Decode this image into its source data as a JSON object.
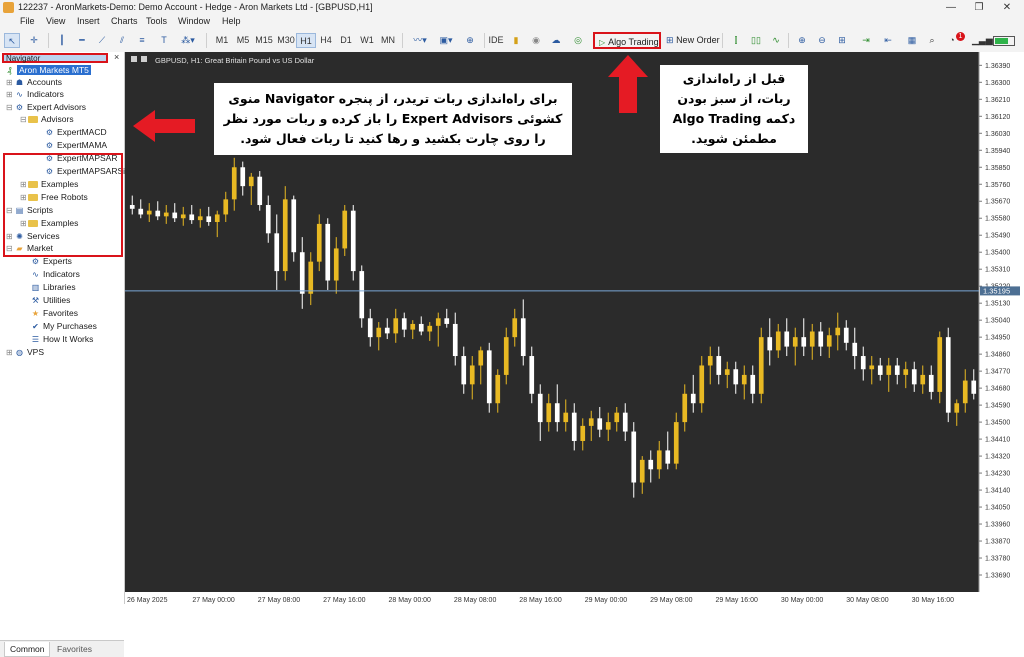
{
  "window": {
    "title": "122237 - AronMarkets-Demo: Demo Account - Hedge - Aron Markets Ltd - [GBPUSD,H1]",
    "controls": [
      "—",
      "❐",
      "✕"
    ]
  },
  "menu": [
    "File",
    "View",
    "Insert",
    "Charts",
    "Tools",
    "Window",
    "Help"
  ],
  "toolbar": {
    "timeframes": [
      "M1",
      "M5",
      "M15",
      "M30",
      "H1",
      "H4",
      "D1",
      "W1",
      "MN"
    ],
    "active_timeframe": "H1",
    "ide_label": "IDE",
    "algo_label": "Algo Trading",
    "new_order_label": "New Order",
    "notification_count": "1"
  },
  "navigator": {
    "title": "Navigator",
    "close": "×",
    "tabs": [
      "Common",
      "Favorites"
    ],
    "items": [
      {
        "label": "Aron Markets MT5"
      },
      {
        "label": "Accounts"
      },
      {
        "label": "Indicators"
      },
      {
        "label": "Expert Advisors"
      },
      {
        "label": "Advisors"
      },
      {
        "label": "ExpertMACD"
      },
      {
        "label": "ExpertMAMA"
      },
      {
        "label": "ExpertMAPSAR"
      },
      {
        "label": "ExpertMAPSARSi"
      },
      {
        "label": "Examples"
      },
      {
        "label": "Free Robots"
      },
      {
        "label": "Scripts"
      },
      {
        "label": "Examples"
      },
      {
        "label": "Services"
      },
      {
        "label": "Market"
      },
      {
        "label": "Experts"
      },
      {
        "label": "Indicators"
      },
      {
        "label": "Libraries"
      },
      {
        "label": "Utilities"
      },
      {
        "label": "Favorites"
      },
      {
        "label": "My Purchases"
      },
      {
        "label": "How It Works"
      },
      {
        "label": "VPS"
      }
    ]
  },
  "chart": {
    "header": "GBPUSD, H1:  Great Britain Pound vs US Dollar",
    "current_price": "1.35195",
    "price_labels": [
      "1.36390",
      "1.36300",
      "1.36210",
      "1.36120",
      "1.36030",
      "1.35940",
      "1.35850",
      "1.35760",
      "1.35670",
      "1.35580",
      "1.35490",
      "1.35400",
      "1.35310",
      "1.35220",
      "1.35130",
      "1.35040",
      "1.34950",
      "1.34860",
      "1.34770",
      "1.34680",
      "1.34590",
      "1.34500",
      "1.34410",
      "1.34320",
      "1.34230",
      "1.34140",
      "1.34050",
      "1.33960",
      "1.33870",
      "1.33780",
      "1.33690"
    ],
    "time_labels": [
      "26 May 2025",
      "27 May 00:00",
      "27 May 08:00",
      "27 May 16:00",
      "28 May 00:00",
      "28 May 08:00",
      "28 May 16:00",
      "29 May 00:00",
      "29 May 08:00",
      "29 May 16:00",
      "30 May 00:00",
      "30 May 08:00",
      "30 May 16:00"
    ]
  },
  "chart_data": {
    "type": "candlestick",
    "symbol": "GBPUSD",
    "timeframe": "H1",
    "ylim": [
      1.336,
      1.3645
    ],
    "bull_color": "#e8b923",
    "bear_color": "#ffffff",
    "bg_color": "#2b2b2b",
    "ohlc": [
      [
        1.3565,
        1.357,
        1.356,
        1.3563
      ],
      [
        1.3563,
        1.3568,
        1.3558,
        1.356
      ],
      [
        1.356,
        1.3566,
        1.3556,
        1.3562
      ],
      [
        1.3562,
        1.3567,
        1.3557,
        1.3559
      ],
      [
        1.3559,
        1.3565,
        1.3555,
        1.3561
      ],
      [
        1.3561,
        1.3566,
        1.3556,
        1.3558
      ],
      [
        1.3558,
        1.3564,
        1.3554,
        1.356
      ],
      [
        1.356,
        1.3565,
        1.3555,
        1.3557
      ],
      [
        1.3557,
        1.3563,
        1.3553,
        1.3559
      ],
      [
        1.3559,
        1.3564,
        1.3554,
        1.3556
      ],
      [
        1.3556,
        1.3562,
        1.3548,
        1.356
      ],
      [
        1.356,
        1.3572,
        1.3556,
        1.3568
      ],
      [
        1.3568,
        1.359,
        1.3562,
        1.3585
      ],
      [
        1.3585,
        1.3588,
        1.357,
        1.3575
      ],
      [
        1.3575,
        1.3582,
        1.3565,
        1.358
      ],
      [
        1.358,
        1.3583,
        1.3562,
        1.3565
      ],
      [
        1.3565,
        1.357,
        1.3545,
        1.355
      ],
      [
        1.355,
        1.356,
        1.352,
        1.353
      ],
      [
        1.353,
        1.3575,
        1.3525,
        1.3568
      ],
      [
        1.3568,
        1.357,
        1.3535,
        1.354
      ],
      [
        1.354,
        1.3548,
        1.351,
        1.3518
      ],
      [
        1.3518,
        1.354,
        1.3512,
        1.3535
      ],
      [
        1.3535,
        1.356,
        1.353,
        1.3555
      ],
      [
        1.3555,
        1.3558,
        1.352,
        1.3525
      ],
      [
        1.3525,
        1.3548,
        1.3518,
        1.3542
      ],
      [
        1.3542,
        1.3565,
        1.3538,
        1.3562
      ],
      [
        1.3562,
        1.3565,
        1.3525,
        1.353
      ],
      [
        1.353,
        1.3533,
        1.35,
        1.3505
      ],
      [
        1.3505,
        1.351,
        1.349,
        1.3495
      ],
      [
        1.3495,
        1.3503,
        1.3488,
        1.35
      ],
      [
        1.35,
        1.3505,
        1.3494,
        1.3497
      ],
      [
        1.3497,
        1.351,
        1.3492,
        1.3505
      ],
      [
        1.3505,
        1.3508,
        1.3495,
        1.3499
      ],
      [
        1.3499,
        1.3504,
        1.3494,
        1.3502
      ],
      [
        1.3502,
        1.3506,
        1.3496,
        1.3498
      ],
      [
        1.3498,
        1.3503,
        1.3493,
        1.3501
      ],
      [
        1.3501,
        1.3508,
        1.349,
        1.3505
      ],
      [
        1.3505,
        1.351,
        1.35,
        1.3502
      ],
      [
        1.3502,
        1.3508,
        1.348,
        1.3485
      ],
      [
        1.3485,
        1.349,
        1.3465,
        1.347
      ],
      [
        1.347,
        1.3485,
        1.3462,
        1.348
      ],
      [
        1.348,
        1.349,
        1.347,
        1.3488
      ],
      [
        1.3488,
        1.3492,
        1.3455,
        1.346
      ],
      [
        1.346,
        1.3478,
        1.3455,
        1.3475
      ],
      [
        1.3475,
        1.35,
        1.347,
        1.3495
      ],
      [
        1.3495,
        1.351,
        1.349,
        1.3505
      ],
      [
        1.3505,
        1.3515,
        1.348,
        1.3485
      ],
      [
        1.3485,
        1.349,
        1.346,
        1.3465
      ],
      [
        1.3465,
        1.347,
        1.344,
        1.345
      ],
      [
        1.345,
        1.3465,
        1.3445,
        1.346
      ],
      [
        1.346,
        1.347,
        1.3445,
        1.345
      ],
      [
        1.345,
        1.3462,
        1.3445,
        1.3455
      ],
      [
        1.3455,
        1.346,
        1.3435,
        1.344
      ],
      [
        1.344,
        1.3452,
        1.3435,
        1.3448
      ],
      [
        1.3448,
        1.3456,
        1.344,
        1.3452
      ],
      [
        1.3452,
        1.3458,
        1.3442,
        1.3446
      ],
      [
        1.3446,
        1.3455,
        1.344,
        1.345
      ],
      [
        1.345,
        1.3458,
        1.3445,
        1.3455
      ],
      [
        1.3455,
        1.346,
        1.344,
        1.3445
      ],
      [
        1.3445,
        1.345,
        1.341,
        1.3418
      ],
      [
        1.3418,
        1.3432,
        1.3412,
        1.343
      ],
      [
        1.343,
        1.3435,
        1.3418,
        1.3425
      ],
      [
        1.3425,
        1.344,
        1.342,
        1.3435
      ],
      [
        1.3435,
        1.3445,
        1.3425,
        1.3428
      ],
      [
        1.3428,
        1.3455,
        1.3425,
        1.345
      ],
      [
        1.345,
        1.347,
        1.3445,
        1.3465
      ],
      [
        1.3465,
        1.3475,
        1.3455,
        1.346
      ],
      [
        1.346,
        1.3485,
        1.3455,
        1.348
      ],
      [
        1.348,
        1.349,
        1.347,
        1.3485
      ],
      [
        1.3485,
        1.349,
        1.347,
        1.3475
      ],
      [
        1.3475,
        1.3482,
        1.3468,
        1.3478
      ],
      [
        1.3478,
        1.3482,
        1.3465,
        1.347
      ],
      [
        1.347,
        1.348,
        1.3462,
        1.3475
      ],
      [
        1.3475,
        1.348,
        1.346,
        1.3465
      ],
      [
        1.3465,
        1.35,
        1.346,
        1.3495
      ],
      [
        1.3495,
        1.3505,
        1.348,
        1.3488
      ],
      [
        1.3488,
        1.3502,
        1.3484,
        1.3498
      ],
      [
        1.3498,
        1.3505,
        1.3485,
        1.349
      ],
      [
        1.349,
        1.35,
        1.348,
        1.3495
      ],
      [
        1.3495,
        1.3505,
        1.3485,
        1.349
      ],
      [
        1.349,
        1.3502,
        1.3483,
        1.3498
      ],
      [
        1.3498,
        1.3503,
        1.3485,
        1.349
      ],
      [
        1.349,
        1.35,
        1.3484,
        1.3496
      ],
      [
        1.3496,
        1.3508,
        1.3488,
        1.35
      ],
      [
        1.35,
        1.3504,
        1.3488,
        1.3492
      ],
      [
        1.3492,
        1.35,
        1.3478,
        1.3485
      ],
      [
        1.3485,
        1.349,
        1.3472,
        1.3478
      ],
      [
        1.3478,
        1.3485,
        1.347,
        1.348
      ],
      [
        1.348,
        1.3484,
        1.3472,
        1.3475
      ],
      [
        1.3475,
        1.3484,
        1.3466,
        1.348
      ],
      [
        1.348,
        1.3484,
        1.347,
        1.3475
      ],
      [
        1.3475,
        1.3482,
        1.3468,
        1.3478
      ],
      [
        1.3478,
        1.3482,
        1.3466,
        1.347
      ],
      [
        1.347,
        1.348,
        1.3465,
        1.3475
      ],
      [
        1.3475,
        1.348,
        1.3462,
        1.3466
      ],
      [
        1.3466,
        1.3498,
        1.346,
        1.3495
      ],
      [
        1.3495,
        1.35,
        1.345,
        1.3455
      ],
      [
        1.3455,
        1.3462,
        1.3448,
        1.346
      ],
      [
        1.346,
        1.3478,
        1.3455,
        1.3472
      ],
      [
        1.3472,
        1.3478,
        1.3462,
        1.3465
      ]
    ]
  },
  "annotations": {
    "left_text": "برای راه‌اندازی ربات تریدر، از پنجره Navigator منوی کشوئی Expert Advisors را باز کرده و ربات مورد نظر را روی چارت بکشید و رها کنید تا ربات فعال شود.",
    "right_text": "قبل از راه‌اندازی ربات، از سبز بودن دکمه Algo Trading مطمئن شوید."
  }
}
